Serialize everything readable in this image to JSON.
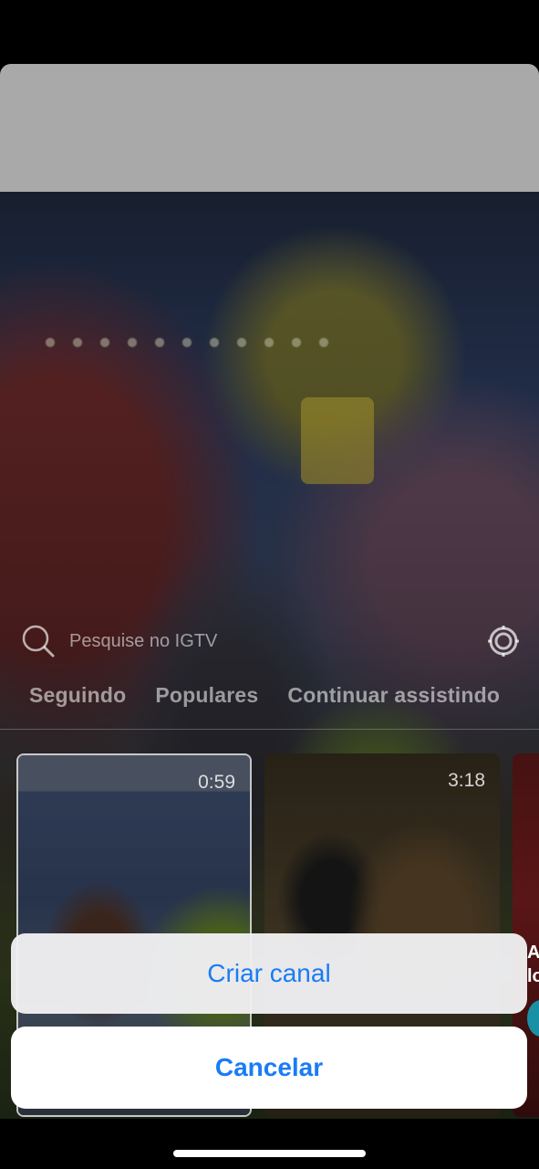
{
  "search": {
    "placeholder_text": "Pesquise no IGTV",
    "icon": "search-icon",
    "settings_icon": "settings-gear-icon"
  },
  "tabs": [
    {
      "label": "Seguindo"
    },
    {
      "label": "Populares"
    },
    {
      "label": "Continuar assistindo"
    }
  ],
  "videos": [
    {
      "duration": "0:59"
    },
    {
      "duration": "3:18"
    },
    {
      "duration": ""
    }
  ],
  "peek": {
    "text_line1": "A",
    "text_line2": "lo"
  },
  "action_sheet": {
    "create_label": "Criar canal",
    "cancel_label": "Cancelar"
  },
  "colors": {
    "accent": "#1a7cf5",
    "sheet_header": "#a9a9a9"
  }
}
